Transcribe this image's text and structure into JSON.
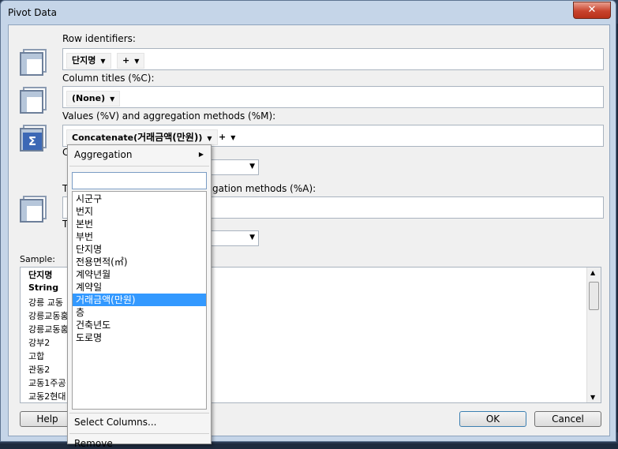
{
  "window": {
    "title": "Pivot Data",
    "close_glyph": "✕"
  },
  "rows": {
    "label": "Row identifiers:",
    "chip": "단지명",
    "plus": "+"
  },
  "columns": {
    "label": "Column titles (%C):",
    "chip": "(None)"
  },
  "values": {
    "label": "Values (%V) and aggregation methods (%M):",
    "chip_prefix": "Concatenate(",
    "chip_field": "거래금액(만원)",
    "chip_suffix": ")",
    "plus": "+"
  },
  "partial_labels": {
    "section4_start": "C",
    "section5_start": "T",
    "section5_end": "gation methods (%A):",
    "section6_start": "T"
  },
  "sample": {
    "label": "Sample:",
    "header": "단지명",
    "type_row": "String",
    "rows": [
      "강릉 교동",
      "강릉교동홍",
      "강릉교동홍",
      "강부2",
      "고합",
      "관동2",
      "교동1주공",
      "교동2현대"
    ]
  },
  "buttons": {
    "help": "Help",
    "ok": "OK",
    "cancel": "Cancel"
  },
  "popup": {
    "aggregation": "Aggregation",
    "search_value": "",
    "items": [
      "시군구",
      "번지",
      "본번",
      "부번",
      "단지명",
      "전용면적(㎡)",
      "계약년월",
      "계약일",
      "거래금액(만원)",
      "층",
      "건축년도",
      "도로명"
    ],
    "selected_index": 8,
    "select_columns": "Select Columns...",
    "remove": "Remove"
  },
  "icons": {
    "row_icon": "table-rows-icon",
    "column_icon": "table-columns-icon",
    "values_icon": "sigma-icon",
    "additional_icon": "table-icon"
  }
}
